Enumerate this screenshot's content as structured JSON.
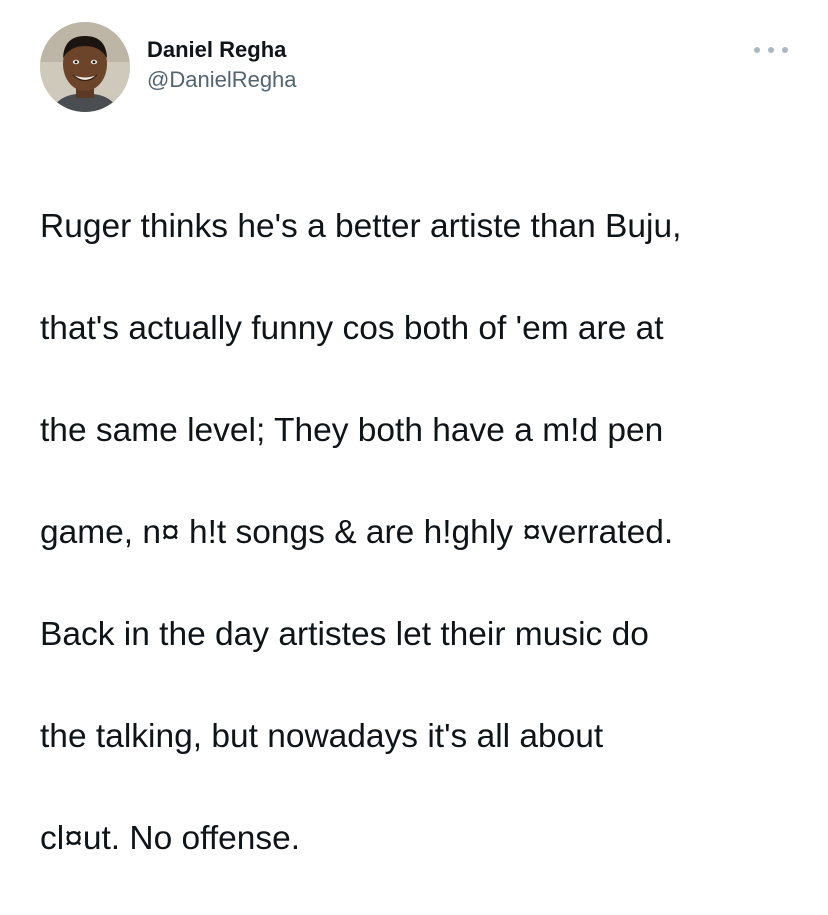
{
  "tweet": {
    "author": {
      "display_name": "Daniel Regha",
      "handle": "@DanielRegha"
    },
    "more_icon": "ellipsis-icon",
    "lines": [
      "Ruger thinks he's a better artiste than Buju,",
      "that's actually funny cos both of 'em are at",
      "the same level; They both have a m!d pen",
      "game, n¤ h!t songs & are h!ghly ¤verrated.",
      "Back in the day artistes let their music do",
      "the talking, but nowadays it's all about",
      "cl¤ut. No offense."
    ]
  },
  "colors": {
    "text": "#0f1419",
    "secondary": "#536471",
    "dots": "#aab8c2",
    "background": "#ffffff"
  }
}
